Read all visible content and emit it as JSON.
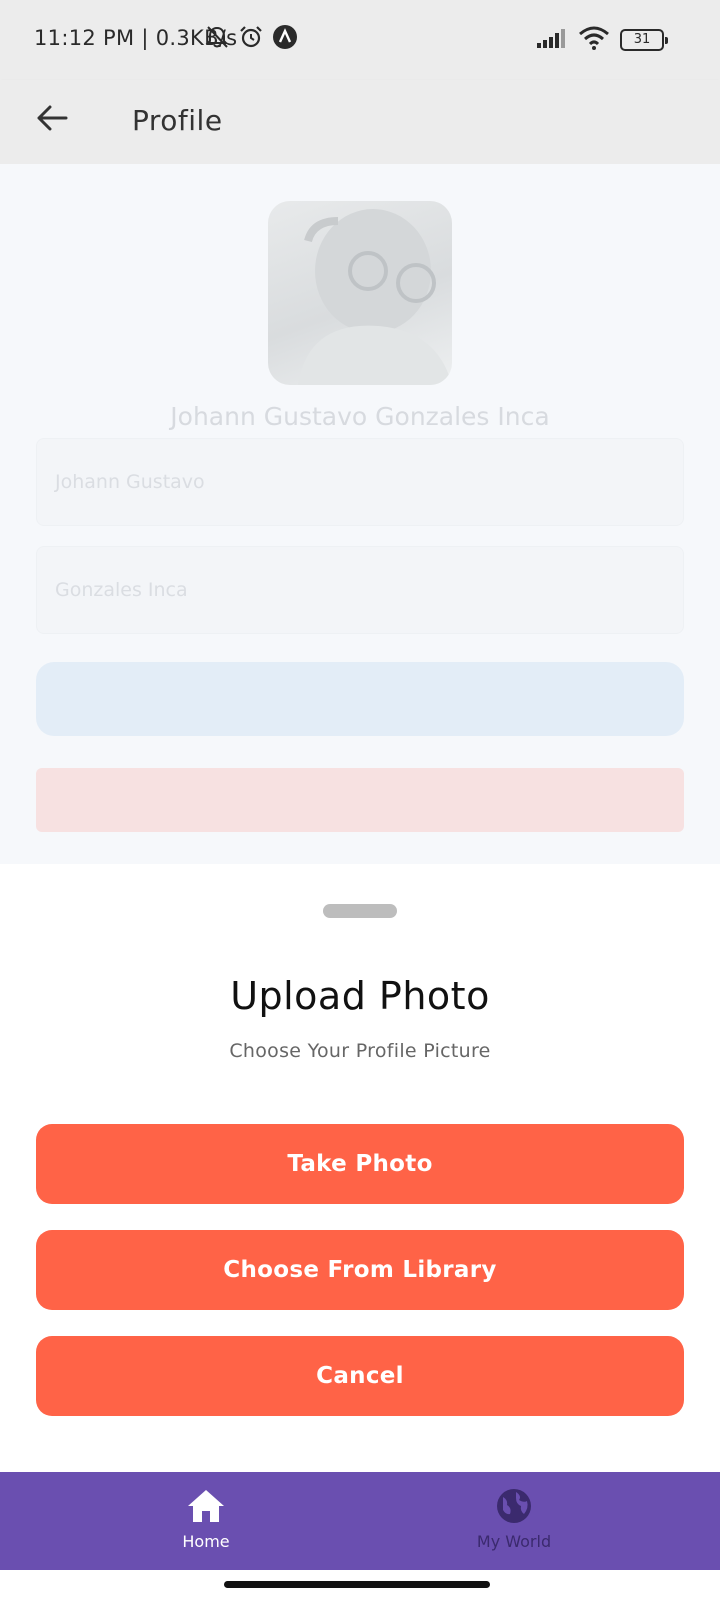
{
  "status_bar": {
    "time": "11:12 PM | 0.3KB/s",
    "battery": "31",
    "icons": [
      "bell-off-icon",
      "alarm-icon",
      "app-notification-icon",
      "signal-icon",
      "wifi-icon",
      "battery-icon"
    ]
  },
  "app_bar": {
    "title": "Profile",
    "back_icon": "arrow-left-icon"
  },
  "profile": {
    "full_name": "Johann Gustavo Gonzales Inca",
    "first_name_value": "Johann Gustavo",
    "last_name_value": "Gonzales Inca"
  },
  "sheet": {
    "title": "Upload Photo",
    "subtitle": "Choose Your Profile Picture",
    "take_photo_label": "Take Photo",
    "choose_library_label": "Choose From Library",
    "cancel_label": "Cancel"
  },
  "bottom_nav": {
    "items": [
      {
        "label": "Home",
        "icon": "home-icon"
      },
      {
        "label": "My World",
        "icon": "globe-icon"
      }
    ]
  },
  "colors": {
    "accent": "#ff6347",
    "nav_background": "#6a4fb0",
    "app_bar": "#ececec"
  }
}
